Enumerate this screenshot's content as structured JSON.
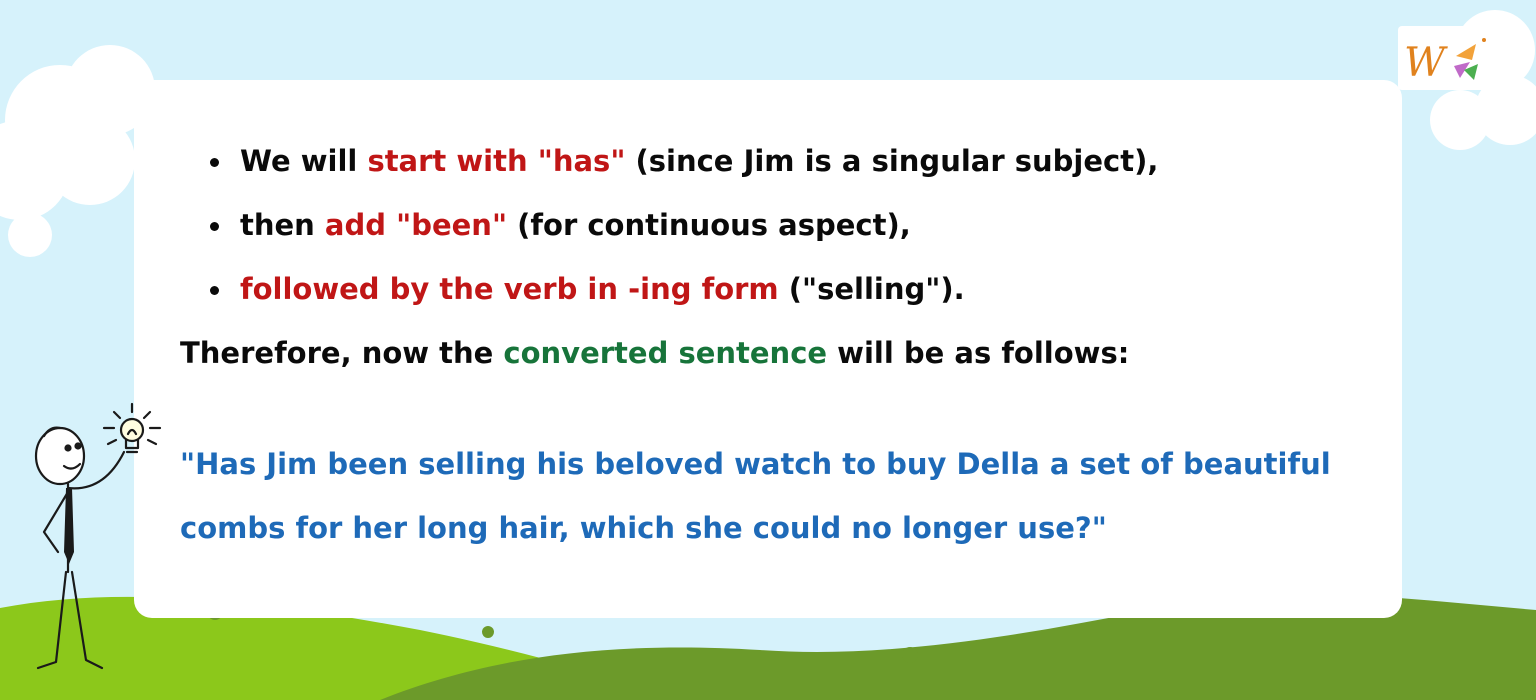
{
  "colors": {
    "sky": "#d6f2fb",
    "card": "#ffffff",
    "grass_light": "#8cc81b",
    "grass_dark": "#6c9a2a",
    "highlight_red": "#c01616",
    "highlight_green": "#17743a",
    "quote_blue": "#1e6ab8",
    "text": "#0a0a0a"
  },
  "bullets": [
    {
      "pre": "We will ",
      "highlight": "start with \"has\"",
      "post": " (since Jim is a singular subject),"
    },
    {
      "pre": "then ",
      "highlight": "add \"been\"",
      "post": " (for continuous aspect),"
    },
    {
      "pre": "",
      "highlight": "followed by the verb in -ing form",
      "post": " (\"selling\")."
    }
  ],
  "conclusion": {
    "pre": "Therefore, now the ",
    "highlight": "converted sentence",
    "post": " will be as follows:"
  },
  "quote": "\"Has Jim been selling his beloved watch to buy Della a set of beautiful combs for her long hair, which she could no longer use?\"",
  "icons": {
    "logo": "brand-logo-w",
    "character": "stick-figure-lightbulb-icon"
  }
}
